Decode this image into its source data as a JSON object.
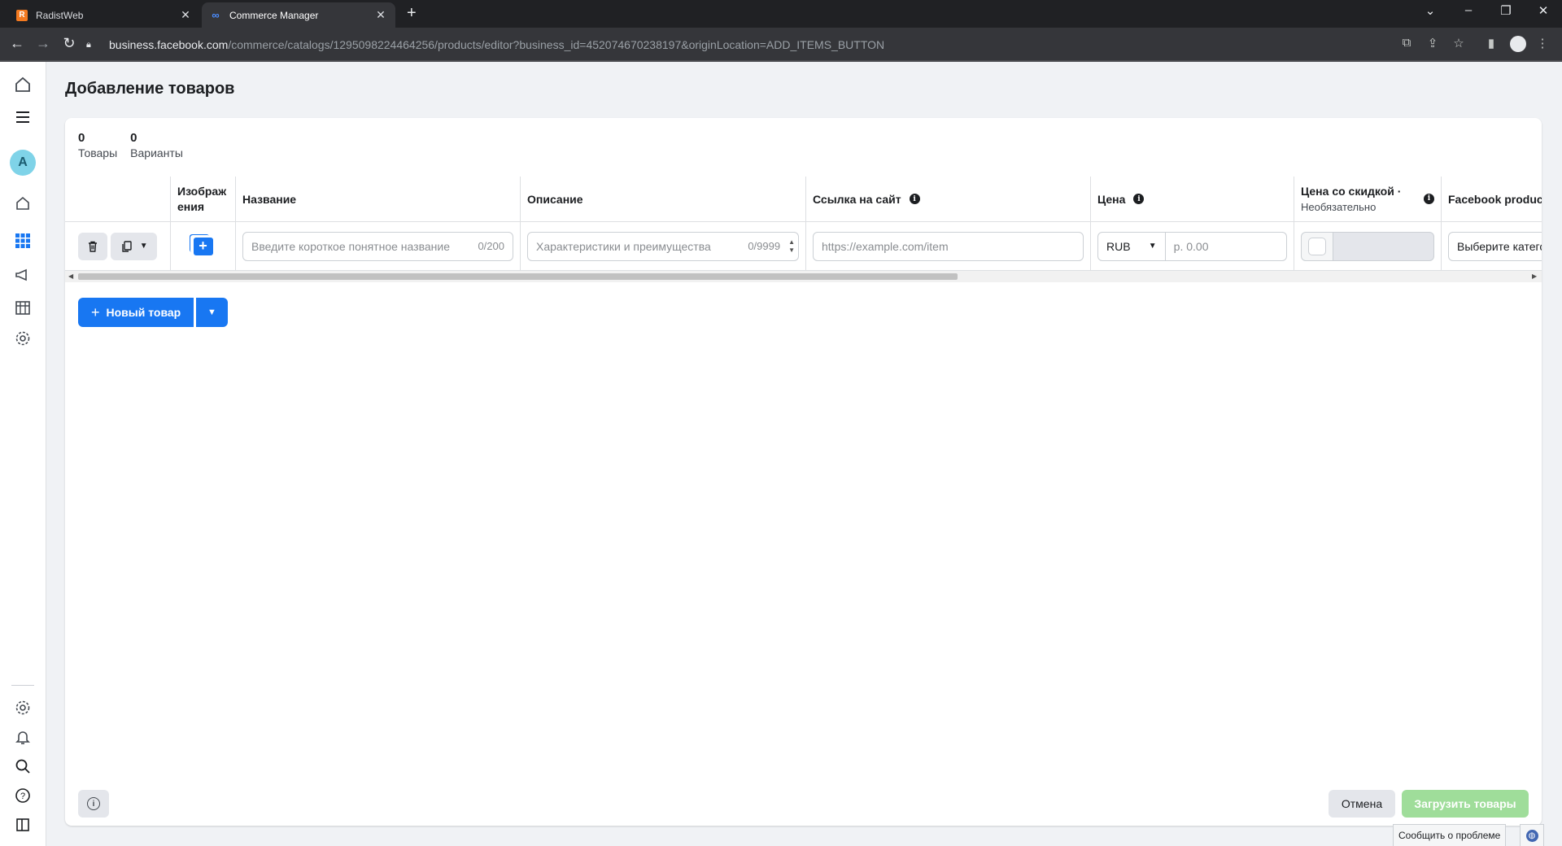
{
  "browser": {
    "tabs": [
      {
        "title": "RadistWeb",
        "favicon": "radistweb-icon"
      },
      {
        "title": "Commerce Manager",
        "favicon": "meta-icon"
      }
    ],
    "url_host": "business.facebook.com",
    "url_path": "/commerce/catalogs/1295098224464256/products/editor?business_id=452074670238197&originLocation=ADD_ITEMS_BUTTON"
  },
  "page": {
    "title": "Добавление товаров"
  },
  "stats": {
    "items": {
      "count": "0",
      "label": "Товары"
    },
    "variants": {
      "count": "0",
      "label": "Варианты"
    }
  },
  "columns": {
    "image_l1": "Изображ",
    "image_l2": "ения",
    "name": "Название",
    "description": "Описание",
    "link": "Ссылка на сайт",
    "price": "Цена",
    "sale_price": "Цена со скидкой ·",
    "sale_price_sub": "Необязательно",
    "category": "Facebook product c"
  },
  "row": {
    "name_placeholder": "Введите короткое понятное название",
    "name_count": "0/200",
    "desc_placeholder": "Характеристики и преимущества",
    "desc_count": "0/9999",
    "link_placeholder": "https://example.com/item",
    "currency": "RUB",
    "price_placeholder": "р. 0.00",
    "category_placeholder": "Выберите катего"
  },
  "actions": {
    "new_item": "Новый товар",
    "cancel": "Отмена",
    "upload": "Загрузить товары",
    "report": "Сообщить о проблеме"
  },
  "colors": {
    "primary": "#1877f2",
    "upload_disabled": "#9fdd9a"
  }
}
